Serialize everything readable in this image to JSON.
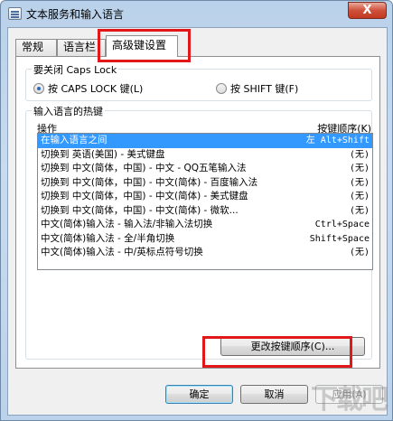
{
  "window": {
    "title": "文本服务和输入语言",
    "close_glyph": "X"
  },
  "tabs": [
    {
      "label": "常规"
    },
    {
      "label": "语言栏"
    },
    {
      "label": "高级键设置"
    }
  ],
  "caps_lock": {
    "title": "要关闭 Caps Lock",
    "option_caps": "按 CAPS LOCK 键(L)",
    "option_shift": "按 SHIFT 键(F)",
    "selected": "option_caps"
  },
  "hotkeys": {
    "title": "输入语言的热键",
    "col_action": "操作",
    "col_sequence": "按键顺序(K)",
    "rows": [
      {
        "action": "在输入语言之间",
        "keys": "左 Alt+Shift"
      },
      {
        "action": "切换到 英语(美国) - 美式键盘",
        "keys": "(无)"
      },
      {
        "action": "切换到 中文(简体，中国) - 中文 - QQ五笔输入法",
        "keys": "(无)"
      },
      {
        "action": "切换到 中文(简体，中国) - 中文(简体) - 百度输入法",
        "keys": "(无)"
      },
      {
        "action": "切换到 中文(简体，中国) - 中文(简体) - 美式键盘",
        "keys": "(无)"
      },
      {
        "action": "切换到 中文(简体，中国) - 中文(简体) - 微软...",
        "keys": "(无)"
      },
      {
        "action": "中文(简体)输入法 - 输入法/非输入法切换",
        "keys": "Ctrl+Space"
      },
      {
        "action": "中文(简体)输入法 - 全/半角切换",
        "keys": "Shift+Space"
      },
      {
        "action": "中文(简体)输入法 - 中/英标点符号切换",
        "keys": "(无)"
      }
    ],
    "change_button": "更改按键顺序(C)..."
  },
  "footer": {
    "ok": "确定",
    "cancel": "取消",
    "apply": "应用(A)"
  },
  "watermark": "下载吧"
}
